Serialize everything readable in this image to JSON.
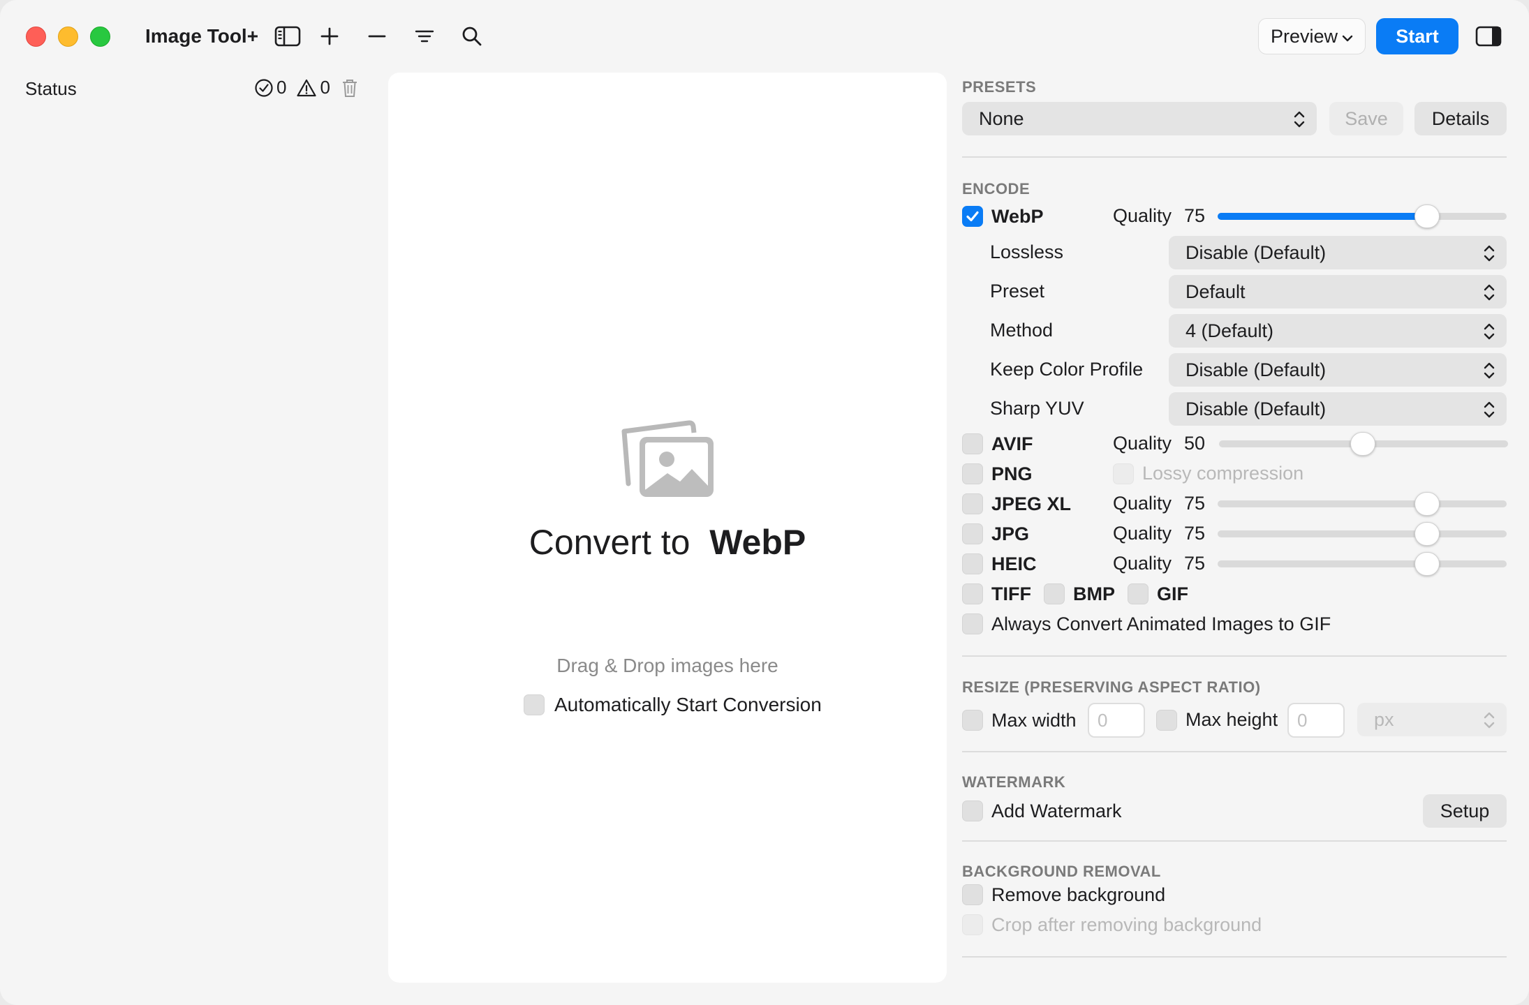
{
  "app": {
    "title": "Image Tool+"
  },
  "toolbar": {
    "preview_label": "Preview",
    "start_label": "Start"
  },
  "sidebar": {
    "status_label": "Status",
    "success_count": "0",
    "warning_count": "0"
  },
  "dropzone": {
    "title_prefix": "Convert to",
    "title_format": "WebP",
    "hint": "Drag & Drop images here",
    "auto_start_label": "Automatically Start Conversion"
  },
  "presets": {
    "title": "PRESETS",
    "selected": "None",
    "save_label": "Save",
    "details_label": "Details"
  },
  "encode": {
    "title": "ENCODE",
    "quality_label": "Quality",
    "webp": {
      "label": "WebP",
      "checked": true,
      "quality": "75",
      "options": [
        {
          "label": "Lossless",
          "value": "Disable (Default)"
        },
        {
          "label": "Preset",
          "value": "Default"
        },
        {
          "label": "Method",
          "value": "4 (Default)"
        },
        {
          "label": "Keep Color Profile",
          "value": "Disable (Default)"
        },
        {
          "label": "Sharp YUV",
          "value": "Disable (Default)"
        }
      ]
    },
    "avif": {
      "label": "AVIF",
      "quality": "50"
    },
    "png": {
      "label": "PNG",
      "lossy_label": "Lossy compression"
    },
    "jpegxl": {
      "label": "JPEG XL",
      "quality": "75"
    },
    "jpg": {
      "label": "JPG",
      "quality": "75"
    },
    "heic": {
      "label": "HEIC",
      "quality": "75"
    },
    "tiff": {
      "label": "TIFF"
    },
    "bmp": {
      "label": "BMP"
    },
    "gif": {
      "label": "GIF"
    },
    "animated_gif_label": "Always Convert Animated Images to GIF"
  },
  "resize": {
    "title": "RESIZE (PRESERVING ASPECT RATIO)",
    "max_width_label": "Max width",
    "max_width_placeholder": "0",
    "max_height_label": "Max height",
    "max_height_placeholder": "0",
    "unit": "px"
  },
  "watermark": {
    "title": "WATERMARK",
    "add_label": "Add Watermark",
    "setup_label": "Setup"
  },
  "background": {
    "title": "BACKGROUND REMOVAL",
    "remove_label": "Remove background",
    "crop_label": "Crop after removing background"
  },
  "colors": {
    "accent": "#0a7cf5",
    "window_bg": "#f5f5f5",
    "panel_white": "#ffffff"
  }
}
